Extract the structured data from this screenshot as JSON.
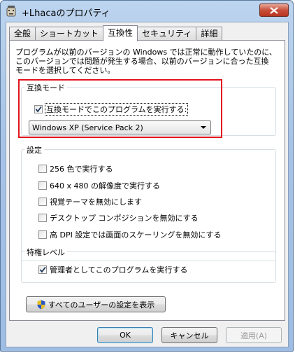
{
  "window": {
    "title": "+Lhacaのプロパティ"
  },
  "tabs": [
    {
      "label": "全般"
    },
    {
      "label": "ショートカット"
    },
    {
      "label": "互換性"
    },
    {
      "label": "セキュリティ"
    },
    {
      "label": "詳細"
    }
  ],
  "intro_text": "プログラムが以前のバージョンの Windows では正常に動作していたのに、\nこのバージョンでは問題が発生する場合、以前のバージョンに合った互換\nモードを選択してください。",
  "compat": {
    "legend": "互換モード",
    "checkbox_label": "互換モードでこのプログラムを実行する:",
    "checked": true,
    "selected_mode": "Windows XP (Service Pack 2)"
  },
  "settings": {
    "legend": "設定",
    "items": [
      {
        "label": "256 色で実行する",
        "checked": false
      },
      {
        "label": "640 x 480 の解像度で実行する",
        "checked": false
      },
      {
        "label": "視覚テーマを無効にします",
        "checked": false
      },
      {
        "label": "デスクトップ コンポジションを無効にする",
        "checked": false
      },
      {
        "label": "高 DPI 設定では画面のスケーリングを無効にする",
        "checked": false
      }
    ]
  },
  "privilege": {
    "legend": "特権レベル",
    "checkbox_label": "管理者としてこのプログラムを実行する",
    "checked": true
  },
  "all_users_button": "すべてのユーザーの設定を表示",
  "buttons": {
    "ok": "OK",
    "cancel": "キャンセル",
    "apply": "適用(A)"
  },
  "colors": {
    "highlight_border": "#e0141e",
    "close_button": "#c8503b"
  }
}
